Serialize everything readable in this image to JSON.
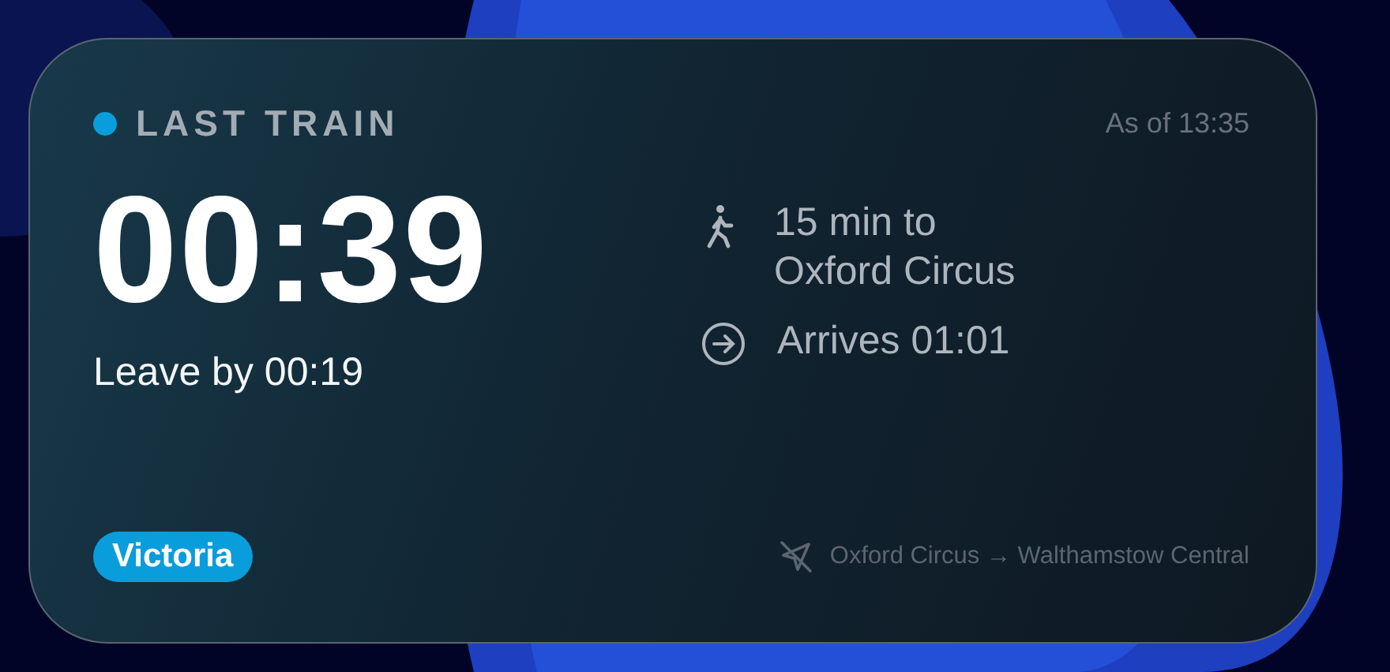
{
  "widget": {
    "status": {
      "label": "LAST TRAIN",
      "color": "#0a9ddb"
    },
    "updated": "As of 13:35",
    "countdown": "00:39",
    "leave_by": "Leave by 00:19",
    "line": {
      "name": "Victoria",
      "color": "#0a9ddb"
    },
    "details": [
      {
        "kind": "walk",
        "text": "15 min to\nOxford Circus"
      },
      {
        "kind": "arrive",
        "text": "Arrives 01:01"
      }
    ],
    "route": "Oxford Circus → Walthamstow Central"
  }
}
